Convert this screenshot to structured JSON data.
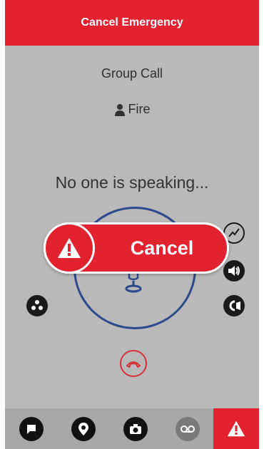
{
  "header": {
    "title": "Cancel Emergency"
  },
  "call": {
    "type": "Group Call",
    "talkgroup": "Fire",
    "status": "No one is speaking..."
  },
  "emergency_banner": {
    "label": "Cancel"
  },
  "side_buttons": {
    "left": [
      "group-members-icon"
    ],
    "right": [
      "signal-icon",
      "speaker-icon",
      "record-icon"
    ]
  },
  "bottom_nav": [
    "chat-icon",
    "location-icon",
    "camera-icon",
    "voicemail-icon",
    "emergency-icon"
  ],
  "colors": {
    "accent": "#e3222f",
    "ring": "#2c4a8c",
    "background": "#b9b9b9"
  }
}
